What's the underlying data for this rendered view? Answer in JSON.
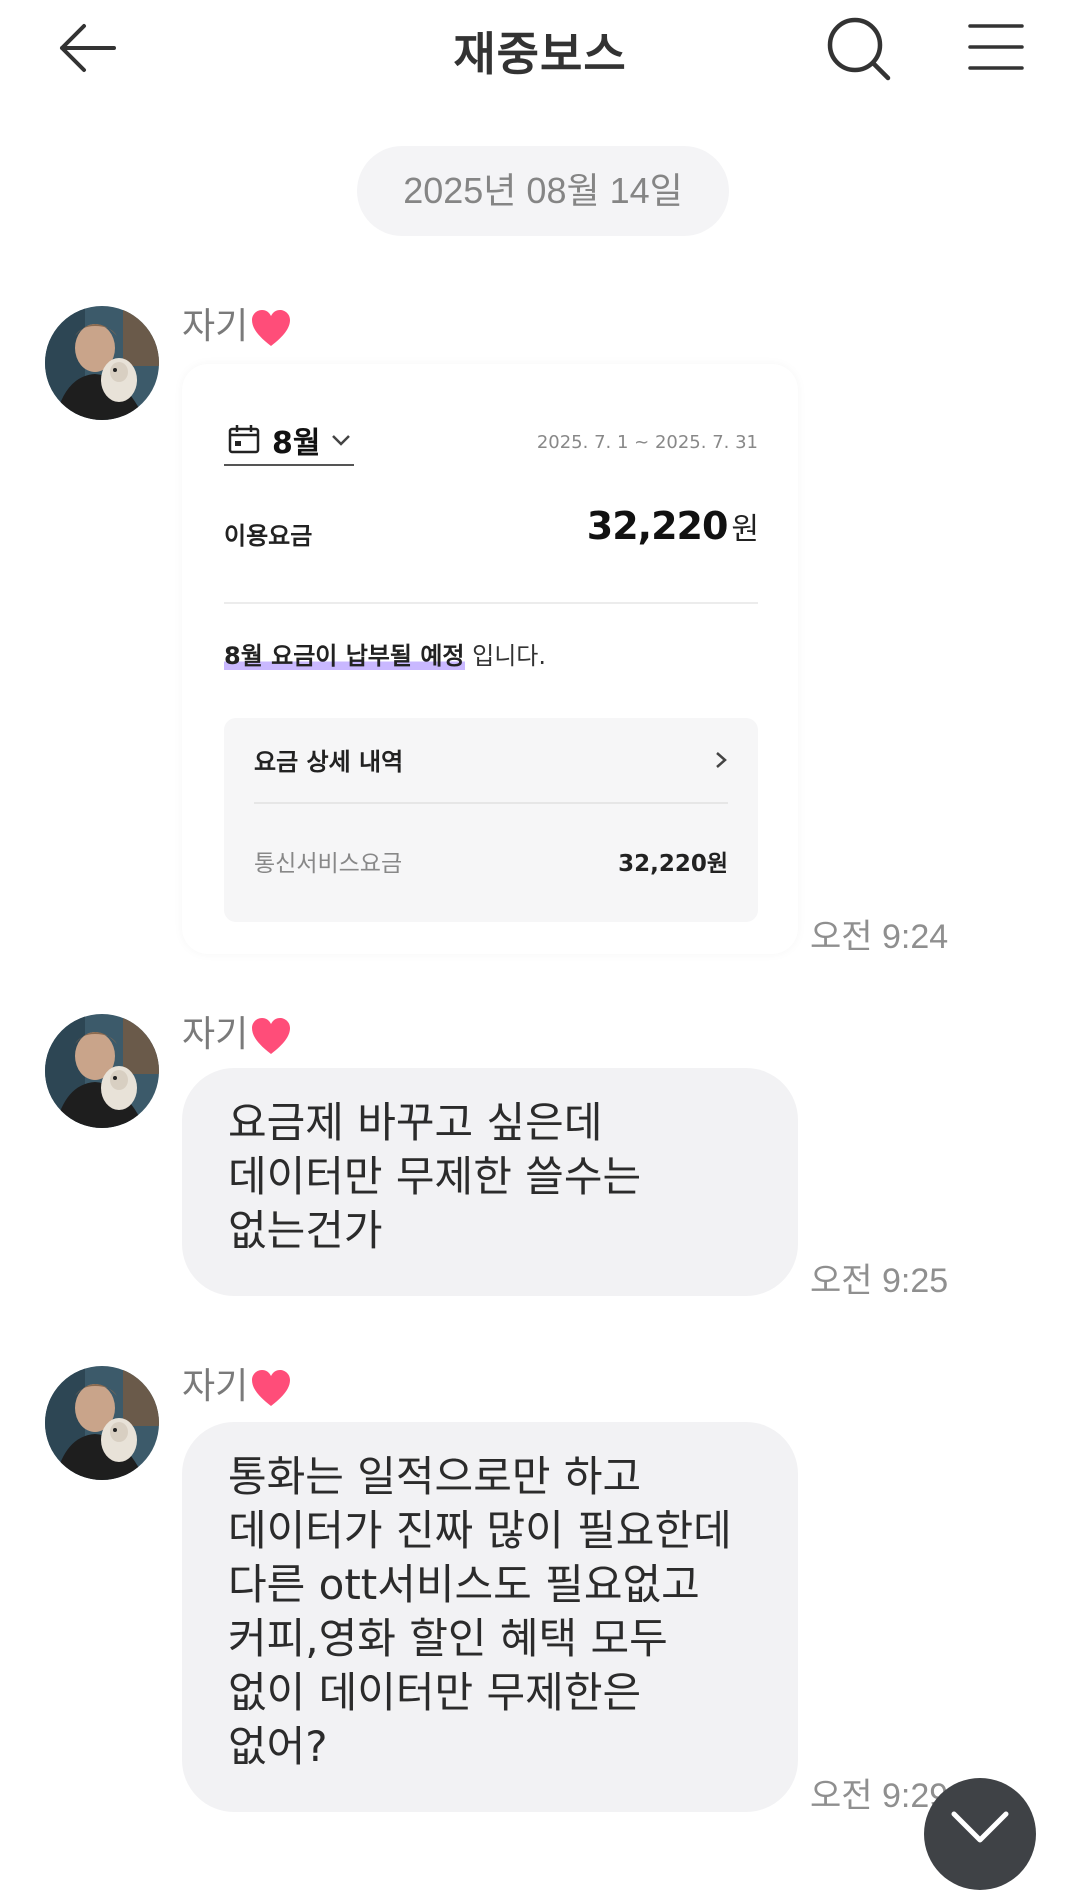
{
  "header": {
    "title": "재중보스"
  },
  "date_divider": "2025년 08월 14일",
  "colors": {
    "bubble_bg": "#f2f2f4",
    "heart": "#ff4d79",
    "fab": "#3f4246",
    "highlight": "#c9b8ff"
  },
  "messages": [
    {
      "sender": "자기",
      "sender_suffix_icon": "heart-icon",
      "type": "image",
      "time": "오전 9:24",
      "image": {
        "month": "8월",
        "period": "2025. 7. 1 ~ 2025. 7. 31",
        "usage_label": "이용요금",
        "usage_amount": "32,220",
        "usage_unit": "원",
        "notice_highlight": "8월 요금이 납부될 예정",
        "notice_rest": " 입니다.",
        "detail_title": "요금 상세 내역",
        "detail_item": "통신서비스요금",
        "detail_amount": "32,220원"
      }
    },
    {
      "sender": "자기",
      "sender_suffix_icon": "heart-icon",
      "type": "text",
      "time": "오전 9:25",
      "lines": [
        "요금제 바꾸고 싶은데",
        "데이터만 무제한 쓸수는",
        "없는건가"
      ]
    },
    {
      "sender": "자기",
      "sender_suffix_icon": "heart-icon",
      "type": "text",
      "time": "오전 9:29",
      "lines": [
        "통화는 일적으로만 하고",
        "데이터가 진짜 많이 필요한데",
        "다른 ott서비스도 필요없고",
        "커피,영화 할인 혜택 모두",
        "없이 데이터만 무제한은",
        "없어?"
      ]
    }
  ]
}
